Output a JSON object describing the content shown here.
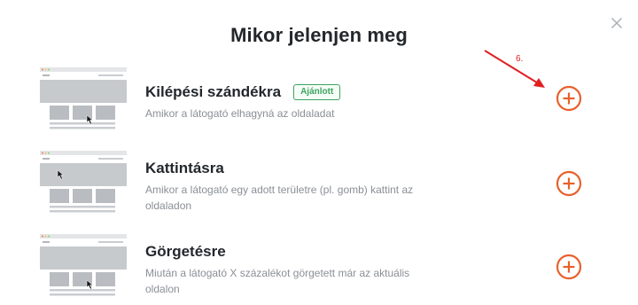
{
  "dialog": {
    "title": "Mikor jelenjen meg",
    "close_icon": "close-icon"
  },
  "options": [
    {
      "title": "Kilépési szándékra",
      "badge": "Ajánlott",
      "description": "Amikor a látogató elhagyná az oldaladat"
    },
    {
      "title": "Kattintásra",
      "badge": "",
      "description": "Amikor a látogató egy adott területre (pl. gomb) kattint az oldaladon"
    },
    {
      "title": "Görgetésre",
      "badge": "",
      "description": "Miután a látogató X százalékot görgetett már az aktuális oldalon"
    }
  ],
  "annotation": {
    "label": "6."
  },
  "colors": {
    "accent": "#e8612c",
    "badge_green": "#3ea45f",
    "annotation_red": "#e02020",
    "thumb_gray": "#c7cacd"
  }
}
